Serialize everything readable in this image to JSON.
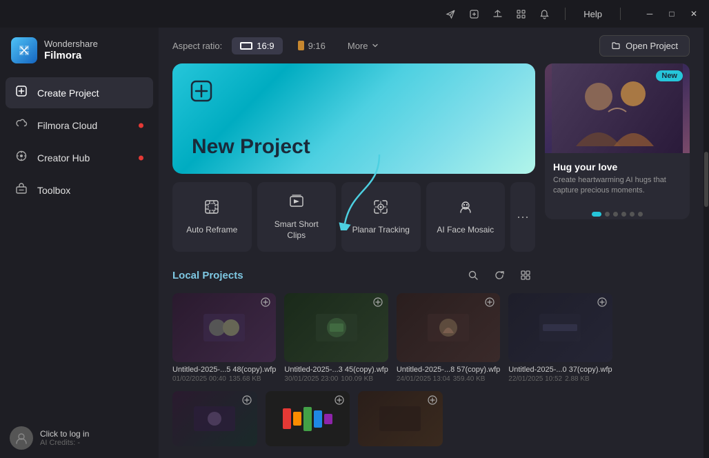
{
  "app": {
    "brand": "Wondershare",
    "product": "Filmora"
  },
  "titlebar": {
    "icons": [
      "send-icon",
      "badge-icon",
      "upload-icon",
      "grid-icon",
      "bell-icon"
    ],
    "help_label": "Help",
    "minimize_label": "─",
    "maximize_label": "□",
    "close_label": "✕"
  },
  "sidebar": {
    "nav_items": [
      {
        "id": "create-project",
        "label": "Create Project",
        "icon": "➕",
        "active": true,
        "dot": false
      },
      {
        "id": "filmora-cloud",
        "label": "Filmora Cloud",
        "icon": "☁",
        "active": false,
        "dot": true
      },
      {
        "id": "creator-hub",
        "label": "Creator Hub",
        "icon": "💡",
        "active": false,
        "dot": true
      },
      {
        "id": "toolbox",
        "label": "Toolbox",
        "icon": "🧰",
        "active": false,
        "dot": false
      }
    ],
    "footer": {
      "login_label": "Click to log in",
      "credits_label": "AI Credits: -"
    }
  },
  "toolbar": {
    "aspect_ratio_label": "Aspect ratio:",
    "aspect_options": [
      {
        "id": "16-9",
        "label": "16:9",
        "active": true
      },
      {
        "id": "9-16",
        "label": "9:16",
        "active": false
      }
    ],
    "more_label": "More",
    "open_project_label": "Open Project"
  },
  "banner": {
    "new_project_label": "New Project",
    "icon": "⊕"
  },
  "tool_cards": [
    {
      "id": "auto-reframe",
      "label": "Auto Reframe",
      "icon": "⊡"
    },
    {
      "id": "smart-short-clips",
      "label": "Smart Short Clips",
      "icon": "⊞"
    },
    {
      "id": "planar-tracking",
      "label": "Planar Tracking",
      "icon": "⊟"
    },
    {
      "id": "ai-face-mosaic",
      "label": "AI Face Mosaic",
      "icon": "⊠"
    }
  ],
  "local_projects": {
    "title": "Local Projects",
    "projects": [
      {
        "id": "proj-1",
        "name": "Untitled-2025-...5 48(copy).wfp",
        "date": "01/02/2025 00:40",
        "size": "135.68 KB",
        "thumb_color": "#2a1a2e"
      },
      {
        "id": "proj-2",
        "name": "Untitled-2025-...3 45(copy).wfp",
        "date": "30/01/2025 23:00",
        "size": "100.09 KB",
        "thumb_color": "#1e2a1e"
      },
      {
        "id": "proj-3",
        "name": "Untitled-2025-...8 57(copy).wfp",
        "date": "24/01/2025 13:04",
        "size": "359.40 KB",
        "thumb_color": "#2a1e1e"
      },
      {
        "id": "proj-4",
        "name": "Untitled-2025-...0 37(copy).wfp",
        "date": "22/01/2025 10:52",
        "size": "2.88 KB",
        "thumb_color": "#1e1e2a"
      }
    ]
  },
  "promo": {
    "new_badge": "New",
    "title": "Hug your love",
    "description": "Create heartwarming AI hugs that capture precious moments.",
    "dots": [
      true,
      false,
      false,
      false,
      false,
      false
    ]
  },
  "colors": {
    "accent": "#26c6da",
    "sidebar_bg": "#1e1e24",
    "content_bg": "#23232b",
    "card_bg": "#2a2a34",
    "active_nav": "#2e2e38"
  }
}
